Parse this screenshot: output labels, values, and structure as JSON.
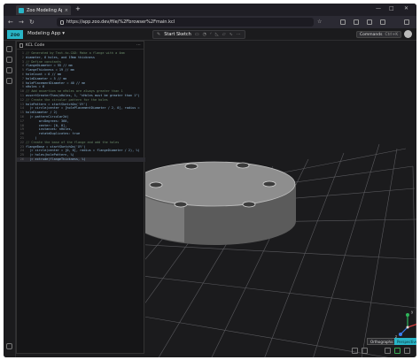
{
  "browser": {
    "tab_title": "Zoo Modeling App",
    "tab_close": "×",
    "new_tab": "+",
    "url": "https://app.zoo.dev/file/%2Fbrowser%2Fmain.kcl",
    "back": "←",
    "forward": "→",
    "reload": "↻",
    "bookmark": "☆",
    "window_controls": [
      "—",
      "□",
      "✕"
    ]
  },
  "app": {
    "logo": "zoo",
    "name": "Modeling App ▾",
    "sketch_button": "Start Sketch",
    "commands_label": "Commands",
    "commands_shortcut": "Ctrl+K"
  },
  "code_panel": {
    "title": "KCL Code",
    "menu": "⋯",
    "lines": [
      "// Generated by Text-to-CAD: Make a flange with a 4mm",
      "diameter, 6 holes, and 19mm thickness",
      "// Define constants",
      "flangeDiameter = 55 // mm",
      "flangeThickness = 19 // mm",
      "holeCount = 6 // mm",
      "holeDiameter = 5 // mm",
      "holePlacementDiameter = 40 // mm",
      "nHoles = 6",
      "// Add assertion so nHoles are always greater than 1",
      "assertGreaterThan(nHoles, 1, \"nHoles must be greater than 1\")",
      "// Create the circular pattern for the holes",
      "holePattern = startSketchOn('XY')",
      "  |> circle(center = [holePlacementDiameter / 2, 0], radius =",
      "holeDiameter / 2)",
      "  |> patternCircular2d(",
      "       arcDegrees: 360,",
      "       center: [0, 0],",
      "       instances: nHoles,",
      "       rotateDuplicates: true",
      "     )",
      "// Create the base of the flange and add the holes",
      "flangeBase = startSketchOn('XY')",
      "  |> circle(center = [0, 0], radius = flangeDiameter / 2), %)",
      "  |> holes(holePattern, %)",
      "  |> extrude(flangeThickness, %)"
    ]
  },
  "viewport": {
    "ortho_label": "Orthographic",
    "persp_label": "Perspective",
    "axis_labels": [
      "x",
      "y",
      "z"
    ]
  }
}
